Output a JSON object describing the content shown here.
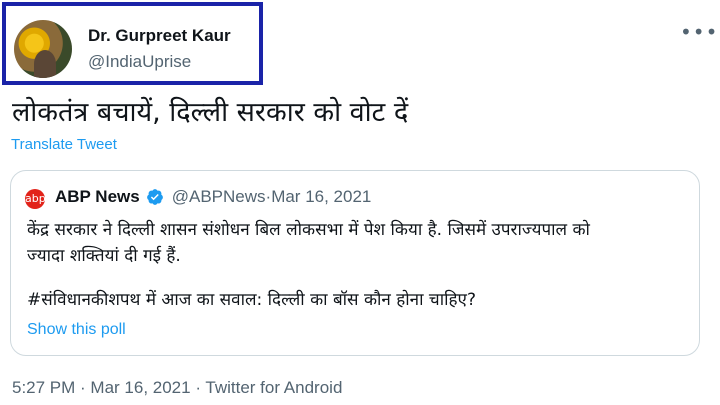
{
  "author": {
    "name": "Dr. Gurpreet Kaur",
    "handle": "@IndiaUprise"
  },
  "more_icon": "more-options-icon",
  "tweet": {
    "text": "लोकतंत्र बचायें, दिल्ली सरकार को वोट दें",
    "translate_label": "Translate Tweet",
    "timestamp": "5:27 PM · Mar 16, 2021 · Twitter for Android"
  },
  "quote": {
    "logo_text": "abp",
    "name": "ABP News",
    "handle": "@ABPNews",
    "separator": " · ",
    "date": "Mar 16, 2021",
    "line1": "केंद्र सरकार ने दिल्ली शासन संशोधन बिल लोकसभा में पेश किया है. जिसमें उपराज्यपाल को",
    "line2": "ज्यादा शक्तियां दी गई हैं.",
    "hashtag_line": "#संविधानकीशपथ में आज का सवाल: दिल्ली का बॉस कौन होना चाहिए?",
    "poll_label": "Show this poll"
  },
  "colors": {
    "link": "#1d9bf0",
    "highlight_border": "#1a23a8",
    "muted": "#536471",
    "verified": "#1d9bf0",
    "abp_red": "#e2231a"
  }
}
